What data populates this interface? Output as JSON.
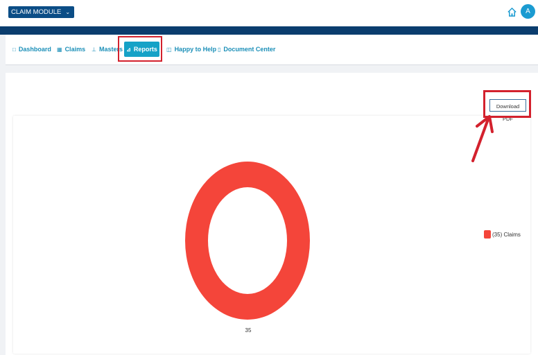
{
  "header": {
    "module_label": "CLAIM MODULE",
    "avatar_initial": "A"
  },
  "nav": {
    "items": [
      {
        "label": "Dashboard",
        "icon": "monitor-icon"
      },
      {
        "label": "Claims",
        "icon": "grid-icon"
      },
      {
        "label": "Masters",
        "icon": "sitemap-icon"
      },
      {
        "label": "Reports",
        "icon": "chart-icon",
        "active": true
      },
      {
        "label": "Happy to Help",
        "icon": "book-icon"
      },
      {
        "label": "Document Center",
        "icon": "file-icon"
      }
    ]
  },
  "report": {
    "download_label": "Download PDF"
  },
  "chart_data": {
    "type": "pie",
    "donut": true,
    "slices": [
      {
        "label": "Claims",
        "value": 35,
        "color": "#f4453a"
      }
    ],
    "legend": [
      {
        "label": "(35)  Claims",
        "color": "#f4453a"
      }
    ],
    "data_labels": [
      "35"
    ],
    "legend_position": "right"
  },
  "colors": {
    "brand": "#0b4d86",
    "nav_active": "#15a2c7",
    "annotation": "#d3212d"
  }
}
